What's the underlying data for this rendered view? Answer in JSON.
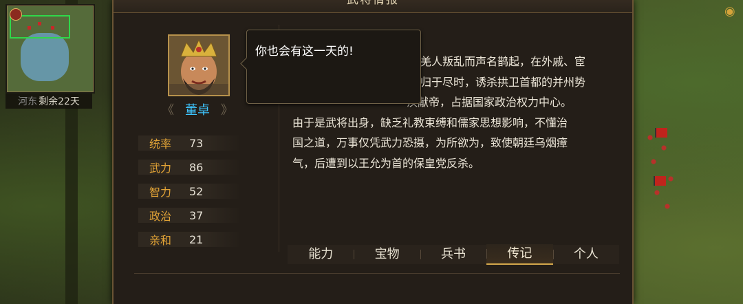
{
  "window": {
    "title": "武将情报"
  },
  "map": {
    "region_name": "河东",
    "days_remaining": "剩余22天"
  },
  "general": {
    "name": "董卓",
    "quote": "你也会有这一天的!",
    "stats": [
      {
        "label": "统率",
        "value": "73"
      },
      {
        "label": "武力",
        "value": "86"
      },
      {
        "label": "智力",
        "value": "52"
      },
      {
        "label": "政治",
        "value": "37"
      },
      {
        "label": "亲和",
        "value": "21"
      }
    ],
    "biography": {
      "lines": [
        "息羌人叛乱而声名鹊起，在外戚、宦",
        "同归于尽时，诱杀拱卫首都的并州势",
        "汉献帝，占据国家政治权力中心。",
        "由于是武将出身，缺乏礼教束缚和儒家思想影响，不懂治",
        "国之道，万事仅凭武力恐摄，为所欲为，致使朝廷乌烟瘴",
        "气，后遭到以王允为首的保皇党反杀。"
      ]
    }
  },
  "tabs": [
    {
      "label": "能力",
      "active": false
    },
    {
      "label": "宝物",
      "active": false
    },
    {
      "label": "兵书",
      "active": false
    },
    {
      "label": "传记",
      "active": true
    },
    {
      "label": "个人",
      "active": false
    }
  ],
  "colors": {
    "accent_gold": "#e3a436",
    "name_blue": "#3ec6ff",
    "panel_bg": "#241e18"
  }
}
